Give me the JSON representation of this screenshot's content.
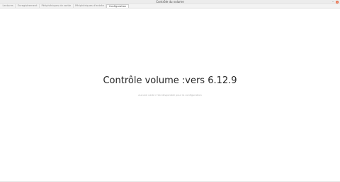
{
  "window": {
    "title": "Contrôle du volume"
  },
  "tabs": [
    {
      "label": "Lectures",
      "active": false
    },
    {
      "label": "Enregistrement",
      "active": false
    },
    {
      "label": "Périphériques de sortie",
      "active": false
    },
    {
      "label": "Périphériques d'entrée",
      "active": false
    },
    {
      "label": "Configuration",
      "active": true
    }
  ],
  "main": {
    "title": "Contrôle volume :vers 6.12.9",
    "message": "aucune carte n'est disponible pour la configuration"
  }
}
